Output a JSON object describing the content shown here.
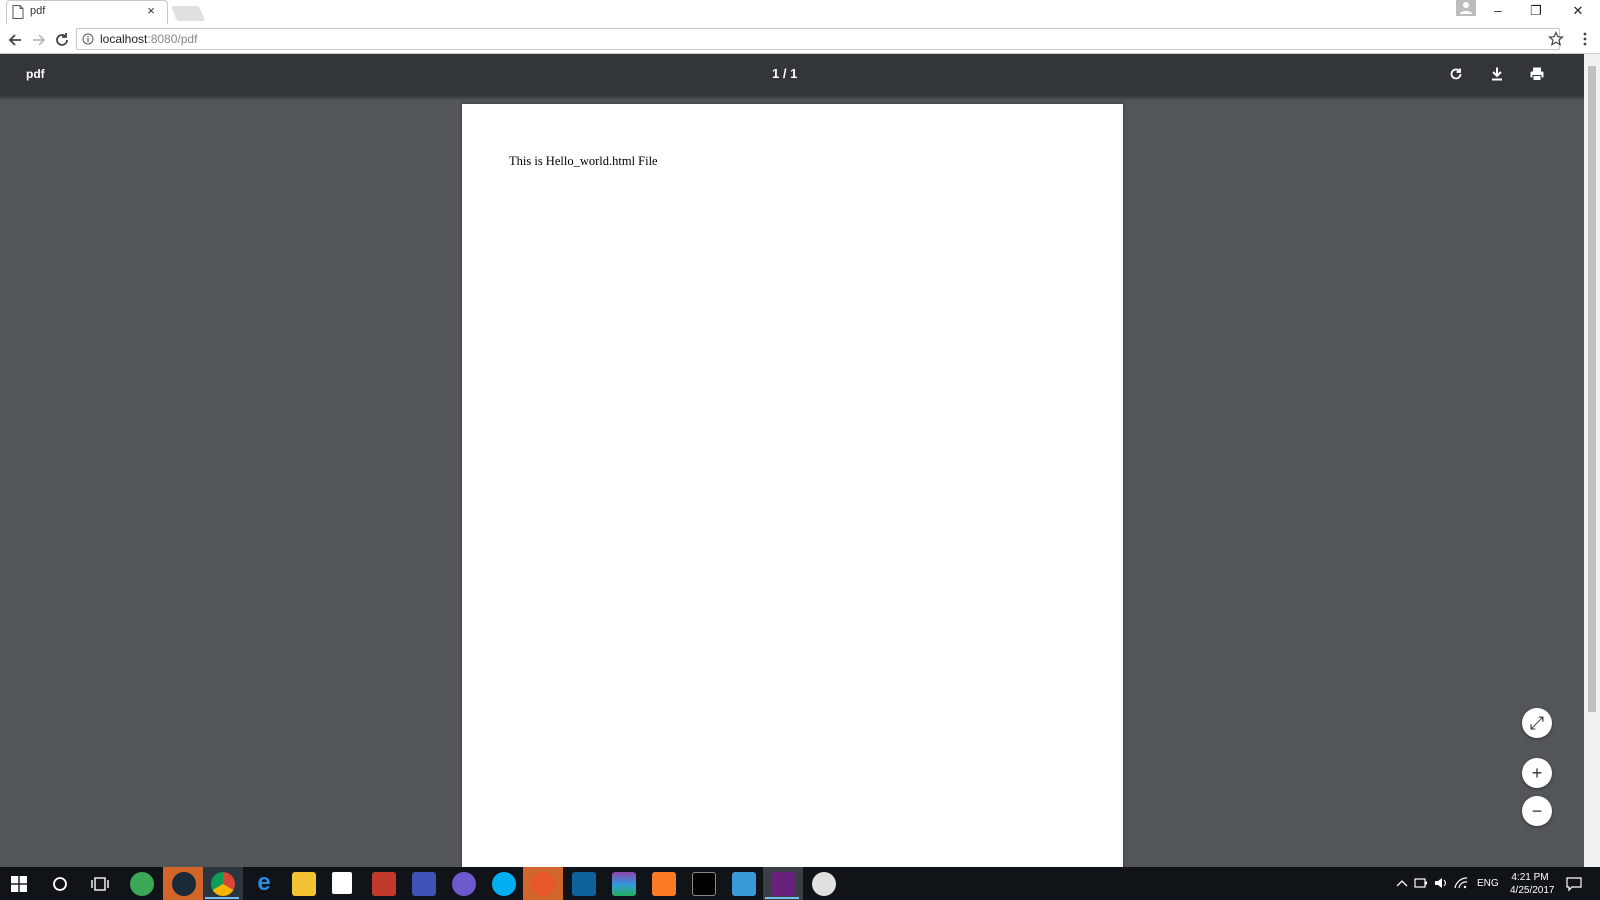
{
  "browser": {
    "tab": {
      "title": "pdf",
      "close": "×"
    },
    "address": {
      "host": "localhost",
      "rest": ":8080/pdf"
    },
    "window_controls": {
      "minimize": "–",
      "restore": "❐",
      "close": "✕"
    }
  },
  "viewer": {
    "title": "pdf",
    "page_indicator": "1 / 1",
    "page_text": "This is Hello_world.html File",
    "fab": {
      "fit": "⤢",
      "zoom_in": "+",
      "zoom_out": "−"
    }
  },
  "taskbar": {
    "apps": [
      "start",
      "cortana",
      "task-view",
      "app-green",
      "steam",
      "chrome",
      "edge",
      "file-explorer",
      "store",
      "app-red",
      "app-blue",
      "app-circle",
      "skype",
      "app-orange",
      "vscode",
      "winrar",
      "xampp",
      "terminal",
      "remote-desktop",
      "visual-studio",
      "paint"
    ],
    "lang": "ENG",
    "time": "4:21 PM",
    "date": "4/25/2017"
  }
}
